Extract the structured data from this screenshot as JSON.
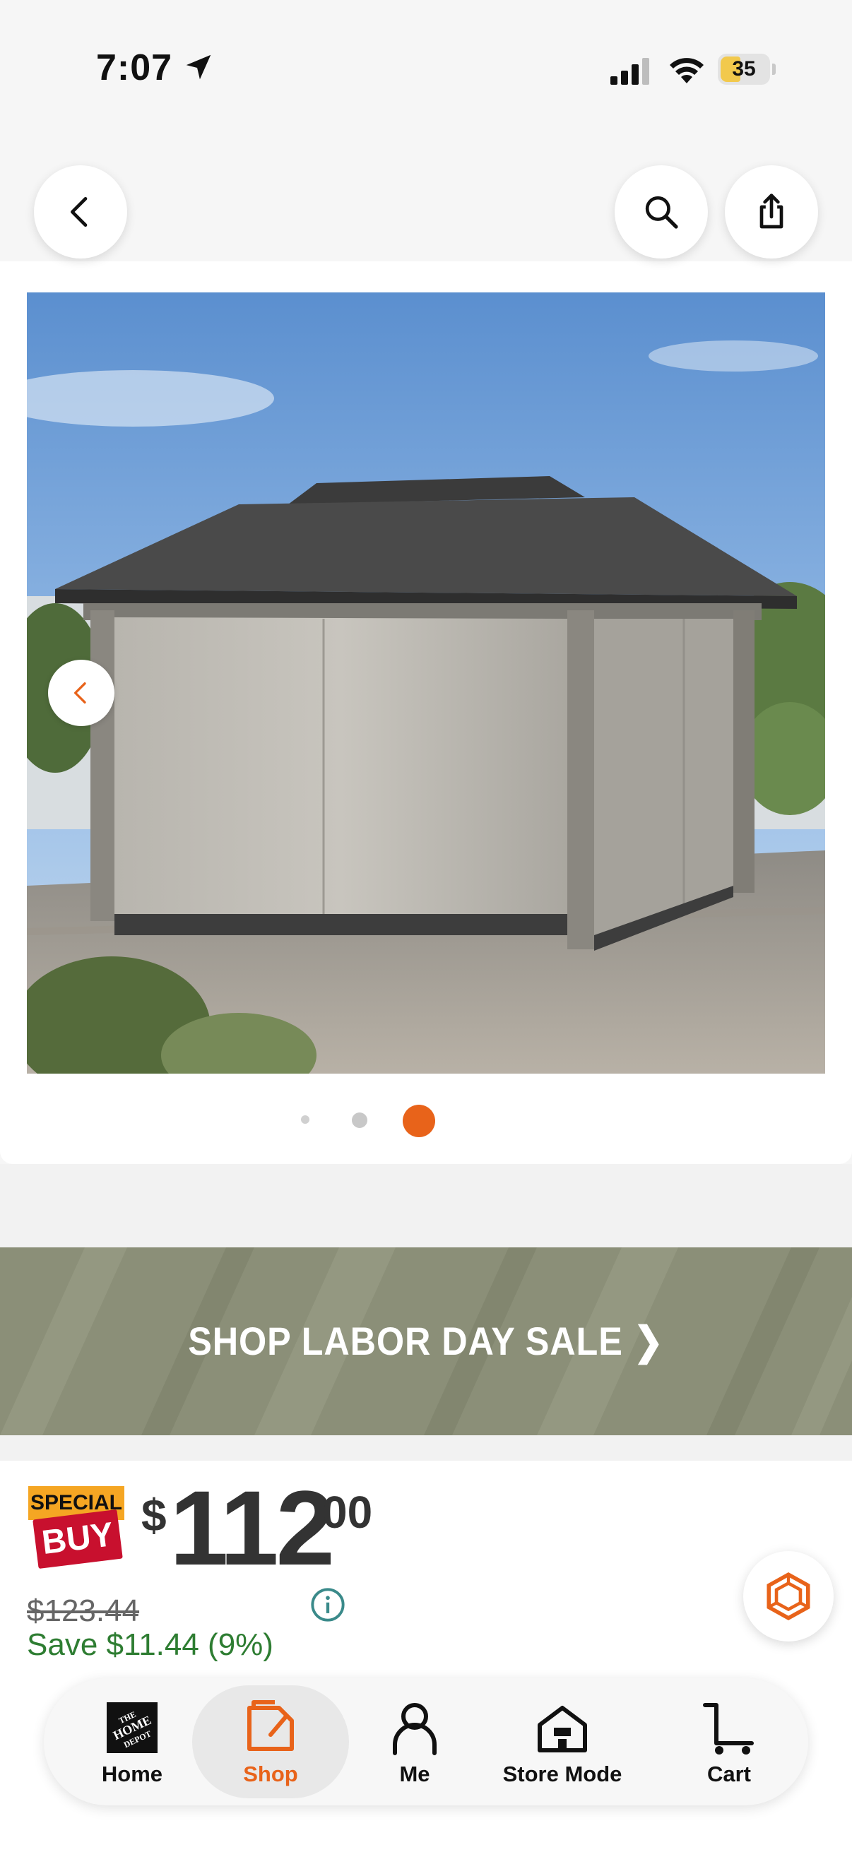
{
  "status_bar": {
    "time": "7:07",
    "battery": "35"
  },
  "header": {
    "back_icon": "chevron-left-icon",
    "search_icon": "search-icon",
    "share_icon": "share-icon"
  },
  "gallery": {
    "image_alt": "Hardtop gazebo with gray curtains on a patio",
    "prev_icon": "chevron-left-icon",
    "dot_count": 3,
    "active_index": 2,
    "accent_color": "#e8631a"
  },
  "promo": {
    "banner_text": "SHOP LABOR DAY SALE ❯"
  },
  "pricing": {
    "badge_top": "SPECIAL",
    "badge_bottom": "BUY",
    "currency": "$",
    "price_whole": "112",
    "price_cents": "00",
    "was_price": "$123.44",
    "savings": "Save $11.44 (9%)",
    "savings_color": "#2e7d32"
  },
  "tabbar": {
    "items": [
      {
        "label": "Home",
        "icon": "home-depot-logo-icon"
      },
      {
        "label": "Shop",
        "icon": "shop-tag-icon",
        "active": true
      },
      {
        "label": "Me",
        "icon": "person-icon"
      },
      {
        "label": "Store Mode",
        "icon": "store-icon"
      },
      {
        "label": "Cart",
        "icon": "cart-icon"
      }
    ],
    "active_color": "#e8631a"
  }
}
